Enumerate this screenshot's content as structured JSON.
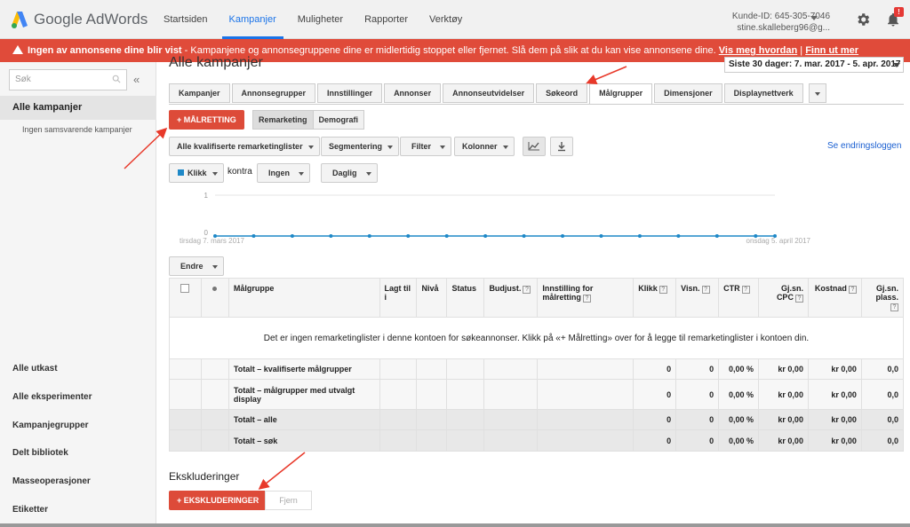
{
  "brand": {
    "name": "Google AdWords"
  },
  "nav": [
    "Startsiden",
    "Kampanjer",
    "Muligheter",
    "Rapporter",
    "Verktøy"
  ],
  "nav_active": "Kampanjer",
  "account": {
    "customer_id": "Kunde-ID: 645-305-7046",
    "email": "stine.skalleberg96@g..."
  },
  "notifications_badge": "!",
  "alert": {
    "bold": "Ingen av annonsene dine blir vist",
    "text": " - Kampanjene og annonsegruppene dine er midlertidig stoppet eller fjernet. Slå dem på slik at du kan vise annonsene dine. ",
    "link1": "Vis meg hvordan",
    "separator": " | ",
    "link2": "Finn ut mer"
  },
  "sidebar": {
    "search_placeholder": "Søk",
    "collapse": "«",
    "active": "Alle kampanjer",
    "sub": "Ingen samsvarende kampanjer",
    "links": [
      "Alle utkast",
      "Alle eksperimenter",
      "Kampanjegrupper",
      "Delt bibliotek",
      "Masseoperasjoner",
      "Etiketter"
    ]
  },
  "main": {
    "title": "Alle kampanjer",
    "date_range": "Siste 30 dager: 7. mar. 2017 - 5. apr. 2017",
    "tabs": [
      "Kampanjer",
      "Annonsegrupper",
      "Innstillinger",
      "Annonser",
      "Annonseutvidelser",
      "Søkeord",
      "Målgrupper",
      "Dimensjoner",
      "Displaynettverk"
    ],
    "tab_active": "Målgrupper",
    "malretting": "+ MÅLRETTING",
    "segment": [
      "Remarketing",
      "Demografi"
    ],
    "filters": {
      "lists": "Alle kvalifiserte remarketinglister",
      "segmentering": "Segmentering",
      "filter": "Filter",
      "kolonner": "Kolonner"
    },
    "change_log": "Se endringsloggen",
    "metric": "Klikk",
    "kontra": "kontra",
    "compare": "Ingen",
    "period": "Daglig",
    "endre": "Endre",
    "ekskluderinger_title": "Ekskluderinger",
    "ekskluderinger_btn": "+ EKSKLUDERINGER",
    "fjern": "Fjern"
  },
  "chart_data": {
    "type": "line",
    "series": [
      {
        "values": [
          0,
          0,
          0,
          0,
          0,
          0,
          0,
          0,
          0,
          0,
          0,
          0,
          0,
          0,
          0,
          0,
          0,
          0,
          0,
          0,
          0,
          0,
          0,
          0,
          0,
          0,
          0,
          0,
          0,
          0
        ]
      }
    ],
    "ylim": [
      0,
      1
    ],
    "y_ticks": [
      "1",
      "0"
    ],
    "x_start_label": "tirsdag 7. mars 2017",
    "x_end_label": "onsdag 5. april 2017",
    "color": "#1e88c7",
    "grid": true
  },
  "table": {
    "headers": [
      "Målgruppe",
      "Lagt til i",
      "Nivå",
      "Status",
      "Budjust.",
      "Innstilling for målretting",
      "Klikk",
      "Visn.",
      "CTR",
      "Gj.sn. CPC",
      "Kostnad",
      "Gj.sn. plass."
    ],
    "empty_message": "Det er ingen remarketinglister i denne kontoen for søkeannonser. Klikk på «+ Målretting» over for å legge til remarketinglister i kontoen din.",
    "rows": [
      {
        "label": "Totalt – kvalifiserte målgrupper",
        "klikk": "0",
        "visn": "0",
        "ctr": "0,00 %",
        "cpc": "kr 0,00",
        "kostnad": "kr 0,00",
        "plass": "0,0"
      },
      {
        "label": "Totalt – målgrupper med utvalgt display",
        "klikk": "0",
        "visn": "0",
        "ctr": "0,00 %",
        "cpc": "kr 0,00",
        "kostnad": "kr 0,00",
        "plass": "0,0"
      },
      {
        "label": "Totalt – alle",
        "klikk": "0",
        "visn": "0",
        "ctr": "0,00 %",
        "cpc": "kr 0,00",
        "kostnad": "kr 0,00",
        "plass": "0,0"
      },
      {
        "label": "Totalt – søk",
        "klikk": "0",
        "visn": "0",
        "ctr": "0,00 %",
        "cpc": "kr 0,00",
        "kostnad": "kr 0,00",
        "plass": "0,0"
      }
    ]
  },
  "colors": {
    "accent": "#1a73e8",
    "alert": "#e04b3a",
    "red_button": "#dd4b39",
    "annotation_arrow": "#e8392a"
  }
}
